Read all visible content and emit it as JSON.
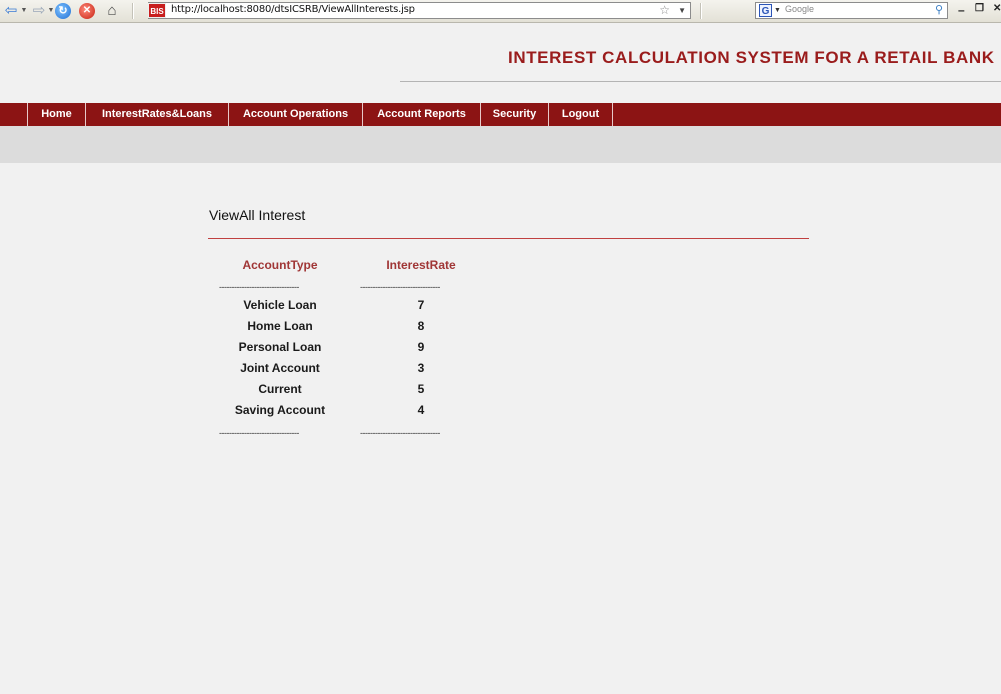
{
  "browser": {
    "url": "http://localhost:8080/dtsICSRB/ViewAllInterests.jsp",
    "favicon_text": "BIS",
    "search_placeholder": "Google",
    "search_engine_letter": "G"
  },
  "header": {
    "title": "INTEREST CALCULATION SYSTEM FOR A RETAIL BANK"
  },
  "nav": {
    "items": [
      {
        "label": "Home"
      },
      {
        "label": "InterestRates&Loans"
      },
      {
        "label": "Account Operations"
      },
      {
        "label": "Account Reports"
      },
      {
        "label": "Security"
      },
      {
        "label": "Logout"
      }
    ]
  },
  "main": {
    "heading": "ViewAll Interest",
    "columns": [
      "AccountType",
      "InterestRate"
    ],
    "divider": "--------------------------------",
    "rows": [
      {
        "type": "Vehicle Loan",
        "rate": "7"
      },
      {
        "type": "Home Loan",
        "rate": "8"
      },
      {
        "type": "Personal Loan",
        "rate": "9"
      },
      {
        "type": "Joint Account",
        "rate": "3"
      },
      {
        "type": "Current",
        "rate": "5"
      },
      {
        "type": "Saving Account",
        "rate": "4"
      }
    ]
  },
  "colors": {
    "brand": "#8c1414",
    "title": "#9a1c1c",
    "column_header": "#a03636"
  }
}
